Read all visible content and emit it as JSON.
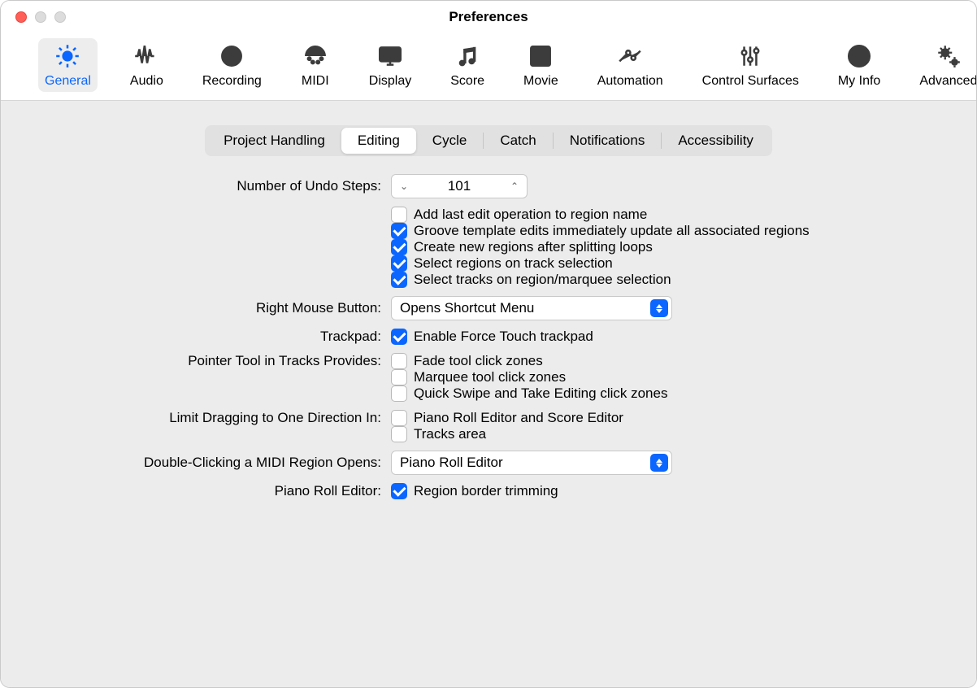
{
  "window": {
    "title": "Preferences"
  },
  "toolbar": [
    {
      "id": "general",
      "label": "General",
      "icon": "gear"
    },
    {
      "id": "audio",
      "label": "Audio",
      "icon": "waveform"
    },
    {
      "id": "recording",
      "label": "Recording",
      "icon": "record"
    },
    {
      "id": "midi",
      "label": "MIDI",
      "icon": "midi"
    },
    {
      "id": "display",
      "label": "Display",
      "icon": "display"
    },
    {
      "id": "score",
      "label": "Score",
      "icon": "notes"
    },
    {
      "id": "movie",
      "label": "Movie",
      "icon": "film"
    },
    {
      "id": "automation",
      "label": "Automation",
      "icon": "automation"
    },
    {
      "id": "control-surfaces",
      "label": "Control Surfaces",
      "icon": "sliders"
    },
    {
      "id": "my-info",
      "label": "My Info",
      "icon": "user"
    },
    {
      "id": "advanced",
      "label": "Advanced",
      "icon": "gears"
    }
  ],
  "toolbar_selected": "general",
  "subtabs": [
    "Project Handling",
    "Editing",
    "Cycle",
    "Catch",
    "Notifications",
    "Accessibility"
  ],
  "subtab_selected": "Editing",
  "form": {
    "undo_label": "Number of Undo Steps:",
    "undo_value": "101",
    "checkboxes_top": [
      {
        "label": "Add last edit operation to region name",
        "checked": false
      },
      {
        "label": "Groove template edits immediately update all associated regions",
        "checked": true
      },
      {
        "label": "Create new regions after splitting loops",
        "checked": true
      },
      {
        "label": "Select regions on track selection",
        "checked": true
      },
      {
        "label": "Select tracks on region/marquee selection",
        "checked": true
      }
    ],
    "right_mouse_label": "Right Mouse Button:",
    "right_mouse_value": "Opens Shortcut Menu",
    "trackpad_label": "Trackpad:",
    "trackpad_check": {
      "label": "Enable Force Touch trackpad",
      "checked": true
    },
    "pointer_label": "Pointer Tool in Tracks Provides:",
    "pointer_checks": [
      {
        "label": "Fade tool click zones",
        "checked": false
      },
      {
        "label": "Marquee tool click zones",
        "checked": false
      },
      {
        "label": "Quick Swipe and Take Editing click zones",
        "checked": false
      }
    ],
    "limit_label": "Limit Dragging to One Direction In:",
    "limit_checks": [
      {
        "label": "Piano Roll Editor and Score Editor",
        "checked": false
      },
      {
        "label": "Tracks area",
        "checked": false
      }
    ],
    "double_click_label": "Double-Clicking a MIDI Region Opens:",
    "double_click_value": "Piano Roll Editor",
    "piano_roll_label": "Piano Roll Editor:",
    "piano_roll_check": {
      "label": "Region border trimming",
      "checked": true
    }
  }
}
